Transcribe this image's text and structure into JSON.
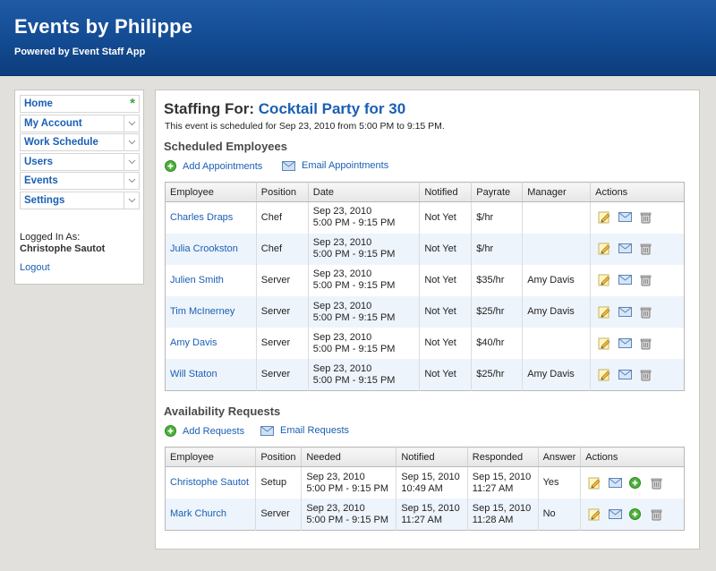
{
  "header": {
    "title": "Events by Philippe",
    "subtitle": "Powered by Event Staff App"
  },
  "sidebar": {
    "items": [
      {
        "label": "Home",
        "marker": "star"
      },
      {
        "label": "My Account",
        "marker": "chevron"
      },
      {
        "label": "Work Schedule",
        "marker": "chevron"
      },
      {
        "label": "Users",
        "marker": "chevron"
      },
      {
        "label": "Events",
        "marker": "chevron"
      },
      {
        "label": "Settings",
        "marker": "chevron"
      }
    ],
    "logged_in_label": "Logged In As:",
    "logged_in_user": "Christophe Sautot",
    "logout": "Logout"
  },
  "main": {
    "title_prefix": "Staffing For:",
    "event_name": "Cocktail Party for 30",
    "schedule_text": "This event is scheduled for Sep 23, 2010 from 5:00 PM to 9:15 PM.",
    "scheduled": {
      "heading": "Scheduled Employees",
      "add_label": "Add Appointments",
      "email_label": "Email Appointments",
      "columns": [
        "Employee",
        "Position",
        "Date",
        "Notified",
        "Payrate",
        "Manager",
        "Actions"
      ],
      "rows": [
        {
          "employee": "Charles Draps",
          "position": "Chef",
          "date1": "Sep 23, 2010",
          "date2": "5:00 PM - 9:15 PM",
          "notified": "Not Yet",
          "payrate": "$/hr",
          "manager": ""
        },
        {
          "employee": "Julia Crookston",
          "position": "Chef",
          "date1": "Sep 23, 2010",
          "date2": "5:00 PM - 9:15 PM",
          "notified": "Not Yet",
          "payrate": "$/hr",
          "manager": ""
        },
        {
          "employee": "Julien Smith",
          "position": "Server",
          "date1": "Sep 23, 2010",
          "date2": "5:00 PM - 9:15 PM",
          "notified": "Not Yet",
          "payrate": "$35/hr",
          "manager": "Amy Davis"
        },
        {
          "employee": "Tim McInerney",
          "position": "Server",
          "date1": "Sep 23, 2010",
          "date2": "5:00 PM - 9:15 PM",
          "notified": "Not Yet",
          "payrate": "$25/hr",
          "manager": "Amy Davis"
        },
        {
          "employee": "Amy Davis",
          "position": "Server",
          "date1": "Sep 23, 2010",
          "date2": "5:00 PM - 9:15 PM",
          "notified": "Not Yet",
          "payrate": "$40/hr",
          "manager": ""
        },
        {
          "employee": "Will Staton",
          "position": "Server",
          "date1": "Sep 23, 2010",
          "date2": "5:00 PM - 9:15 PM",
          "notified": "Not Yet",
          "payrate": "$25/hr",
          "manager": "Amy Davis"
        }
      ]
    },
    "availability": {
      "heading": "Availability Requests",
      "add_label": "Add Requests",
      "email_label": "Email Requests",
      "columns": [
        "Employee",
        "Position",
        "Needed",
        "Notified",
        "Responded",
        "Answer",
        "Actions"
      ],
      "rows": [
        {
          "employee": "Christophe Sautot",
          "position": "Setup",
          "needed1": "Sep 23, 2010",
          "needed2": "5:00 PM - 9:15 PM",
          "notified1": "Sep 15, 2010",
          "notified2": "10:49 AM",
          "responded1": "Sep 15, 2010",
          "responded2": "11:27 AM",
          "answer": "Yes"
        },
        {
          "employee": "Mark Church",
          "position": "Server",
          "needed1": "Sep 23, 2010",
          "needed2": "5:00 PM - 9:15 PM",
          "notified1": "Sep 15, 2010",
          "notified2": "11:27 AM",
          "responded1": "Sep 15, 2010",
          "responded2": "11:28 AM",
          "answer": "No"
        }
      ]
    }
  },
  "colors": {
    "header_bg": "#134b92",
    "link": "#1a5fb4",
    "alt_row": "#eef4fc",
    "page_bg": "#e2e0dc"
  }
}
